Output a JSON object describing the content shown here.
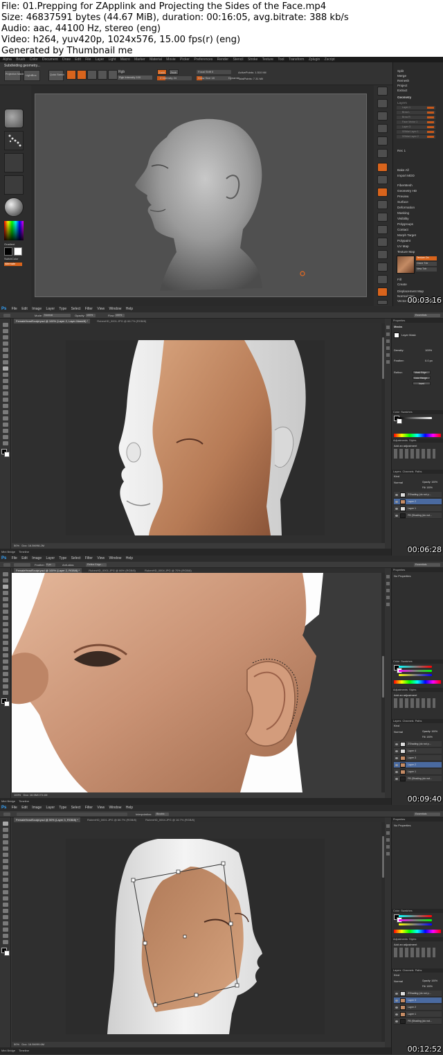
{
  "meta": {
    "line1": "File: 01.Prepping for ZApplink and Projecting the Sides of the Face.mp4",
    "line2": "Size: 46837591 bytes (44.67 MiB), duration: 00:16:05, avg.bitrate: 388 kb/s",
    "line3": "Audio: aac, 44100 Hz, stereo (eng)",
    "line4": "Video: h264, yuv420p, 1024x576, 15.00 fps(r) (eng)",
    "line5": "Generated by Thumbnail me"
  },
  "frames": [
    {
      "app": "ZBrush",
      "timestamp": "00:03:16"
    },
    {
      "app": "Photoshop",
      "timestamp": "00:06:28"
    },
    {
      "app": "Photoshop",
      "timestamp": "00:09:40"
    },
    {
      "app": "Photoshop",
      "timestamp": "00:12:52"
    }
  ],
  "zbrush": {
    "menus": [
      "Alpha",
      "Brush",
      "Color",
      "Document",
      "Draw",
      "Edit",
      "File",
      "Layer",
      "Light",
      "Macro",
      "Marker",
      "Material",
      "Movie",
      "Picker",
      "Preferences",
      "Render",
      "Stencil",
      "Stroke",
      "Texture",
      "Tool",
      "Transform",
      "Zplugin",
      "Zscript"
    ],
    "status": "Subdividing geometry...",
    "toolbar": {
      "projection_master": "Projection Master",
      "lightbox": "LightBox",
      "quick_sketch": "Quick Sketch",
      "edit": "Edit",
      "draw": "Draw",
      "move": "Move",
      "scale": "Scale",
      "rotate": "Rotate",
      "rgb": "Rgb",
      "rgb_intensity": "Rgb Intensity 100",
      "zadd": "Zadd",
      "zsub": "Zsub",
      "z_intensity": "Z Intensity 24",
      "focal_shift": "Focal Shift 0",
      "draw_size": "Draw Size 18",
      "dynamic": "Dynamic",
      "active_points": "ActivePoints: 1.510 Mil",
      "total_points": "TotalPoints: 7.31 Mil"
    },
    "left": {
      "gradient": "Gradient",
      "switch_color": "SwitchColor",
      "alternate": "Alternate"
    },
    "panel": {
      "top": [
        "Split",
        "Merge",
        "Remesh",
        "Project",
        "Extract"
      ],
      "geometry": "Geometry",
      "layers_label": "Layers",
      "layers": [
        "Layer 1",
        "Brow L",
        "Brow R",
        "Face Vector 1",
        "Layer 3",
        "SSMat Layer 1",
        "SSMat Layer 2"
      ],
      "mid": [
        "Rec 1",
        "Bake All",
        "Import MDD"
      ],
      "sections": [
        "FiberMesh",
        "Geometry HD",
        "Preview",
        "Surface",
        "Deformation",
        "Masking",
        "Visibility",
        "Polygroups",
        "Contact",
        "Morph Target",
        "Polypaint",
        "UV Map",
        "Texture Map"
      ],
      "texture_items": [
        "Texture On",
        "Clone Txtr",
        "New Txtr"
      ],
      "bottom": [
        "Fill",
        "Create",
        "Displacement Map",
        "Normal Map",
        "Vector Displacement Map"
      ]
    }
  },
  "ps": {
    "menus": [
      "File",
      "Edit",
      "Image",
      "Layer",
      "Type",
      "Select",
      "Filter",
      "View",
      "Window",
      "Help"
    ],
    "essentials": "Essentials",
    "frame2": {
      "tab_active": "FemaleHeadSculpt.psd @ 100% (Layer 2, Layer Mask/8) *",
      "tabs": [
        "RubenHD_0001.JPG @ 66.7% (RGB/8)"
      ],
      "mode": "Mode:",
      "mode_val": "Normal",
      "opacity": "Opacity:",
      "opacity_val": "100%",
      "flow": "Flow:",
      "flow_val": "100%",
      "zoom": "50%",
      "doc_size": "Doc: 16.5M/98.2M",
      "bottom_tabs": [
        "Mini Bridge",
        "Timeline"
      ],
      "properties": "Properties",
      "masks": "Masks",
      "layer_mask": "Layer Mask",
      "density": "Density:",
      "density_val": "100%",
      "feather": "Feather:",
      "feather_val": "0.0 px",
      "refine": "Refine:",
      "refine_btns": [
        "Mask Edge...",
        "Color Range...",
        "Invert"
      ],
      "color_tab": "Color",
      "swatches_tab": "Swatches",
      "adjustments": "Adjustments",
      "styles": "Styles",
      "add_adjustment": "Add an adjustment",
      "layers_tab": "Layers",
      "channels_tab": "Channels",
      "paths_tab": "Paths",
      "kind": "Kind",
      "blend": "Normal",
      "opacity2": "Opacity: 100%",
      "fill": "Fill: 100%",
      "layers": [
        "ZShading (do not p...",
        "Layer 2",
        "Layer 1",
        "FB (Shading (do not..."
      ]
    },
    "frame3": {
      "tab_active": "FemaleHeadSculpt.psd @ 100% (Layer 2, RGB/8) *",
      "tabs": [
        "RubenHD_0001.JPG @ 66% (RGB/8)",
        "RubenHD_0004.JPG @ 70% (RGB/8)"
      ],
      "feather": "Feather:",
      "feather_val": "0 px",
      "anti_alias": "Anti-alias",
      "refine_edge": "Refine Edge...",
      "zoom": "100%",
      "doc_size": "Doc: 16.5M/173.1M",
      "no_properties": "No Properties",
      "layers": [
        "ZShading (do not p...",
        "Layer 4",
        "Layer 3",
        "Layer 2",
        "Layer 1",
        "FB (Shading (do not..."
      ]
    },
    "frame4": {
      "tab_active": "FemaleHeadSculpt.psd @ 50% (Layer 3, RGB/8) *",
      "tabs": [
        "RubenHD_0001.JPG @ 66.7% (RGB/8)",
        "RubenHD_0004.JPG @ 16.7% (RGB/8)"
      ],
      "interpolation": "Interpolation:",
      "interp_val": "Bicubic",
      "zoom": "50%",
      "doc_size": "Doc: 16.5M/99.6M",
      "no_properties": "No Properties",
      "layers": [
        "ZShading (do not p...",
        "Layer 3",
        "Layer 2",
        "Layer 1",
        "FB (Shading (do not..."
      ]
    }
  }
}
